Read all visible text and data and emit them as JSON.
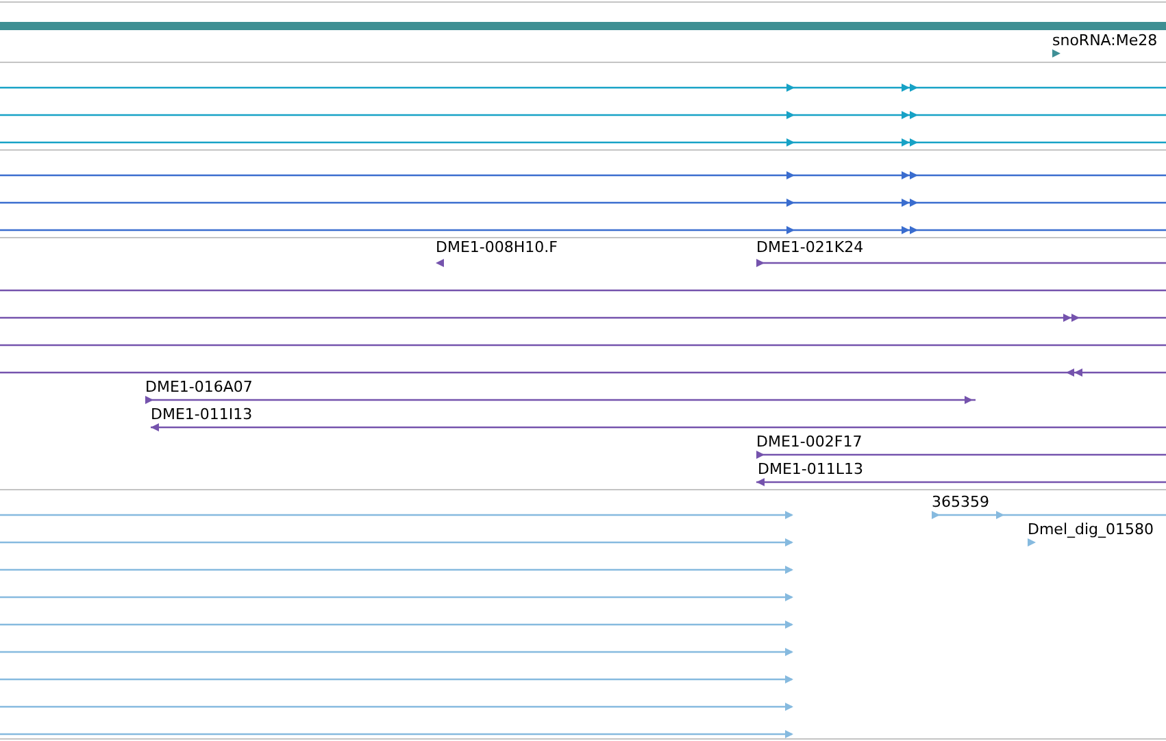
{
  "tracks": [
    {
      "kind": "ncrna",
      "rows": [
        {
          "features": [
            {
              "label": "snoRNA:Me28",
              "kind": "forward"
            }
          ]
        }
      ]
    },
    {
      "kind": "transcript_a",
      "rows": [
        {
          "features": [
            {
              "kind": "forward"
            }
          ]
        },
        {
          "features": [
            {
              "kind": "forward"
            }
          ]
        },
        {
          "features": [
            {
              "kind": "forward"
            }
          ]
        }
      ]
    },
    {
      "kind": "transcript_b",
      "rows": [
        {
          "features": [
            {
              "kind": "forward"
            }
          ]
        },
        {
          "features": [
            {
              "kind": "forward"
            }
          ]
        },
        {
          "features": [
            {
              "kind": "forward"
            }
          ]
        }
      ]
    },
    {
      "kind": "clone",
      "rows": [
        {
          "features": [
            {
              "label": "DME1-008H10.F",
              "kind": "reverse"
            },
            {
              "label": "DME1-021K24",
              "kind": "forward"
            }
          ]
        },
        {
          "features": [
            {
              "kind": "span"
            }
          ]
        },
        {
          "features": [
            {
              "kind": "forward"
            }
          ]
        },
        {
          "features": [
            {
              "kind": "span"
            }
          ]
        },
        {
          "features": [
            {
              "kind": "reverse"
            }
          ]
        },
        {
          "features": [
            {
              "label": "DME1-016A07",
              "kind": "forward"
            }
          ]
        },
        {
          "features": [
            {
              "label": "DME1-011I13",
              "kind": "reverse"
            }
          ]
        },
        {
          "features": [
            {
              "label": "DME1-002F17",
              "kind": "forward"
            }
          ]
        },
        {
          "features": [
            {
              "label": "DME1-011L13",
              "kind": "reverse"
            }
          ]
        }
      ]
    },
    {
      "kind": "match",
      "rows": [
        {
          "features": [
            {
              "kind": "forward"
            },
            {
              "label": "365359",
              "kind": "forward"
            }
          ]
        },
        {
          "features": [
            {
              "kind": "forward"
            },
            {
              "label": "Dmel_dig_01580",
              "kind": "forward"
            }
          ]
        },
        {
          "features": [
            {
              "kind": "forward"
            }
          ]
        },
        {
          "features": [
            {
              "kind": "forward"
            }
          ]
        },
        {
          "features": [
            {
              "kind": "forward"
            }
          ]
        },
        {
          "features": [
            {
              "kind": "forward"
            }
          ]
        },
        {
          "features": [
            {
              "kind": "forward"
            }
          ]
        },
        {
          "features": [
            {
              "kind": "forward"
            }
          ]
        },
        {
          "features": [
            {
              "kind": "forward"
            }
          ]
        }
      ]
    }
  ]
}
